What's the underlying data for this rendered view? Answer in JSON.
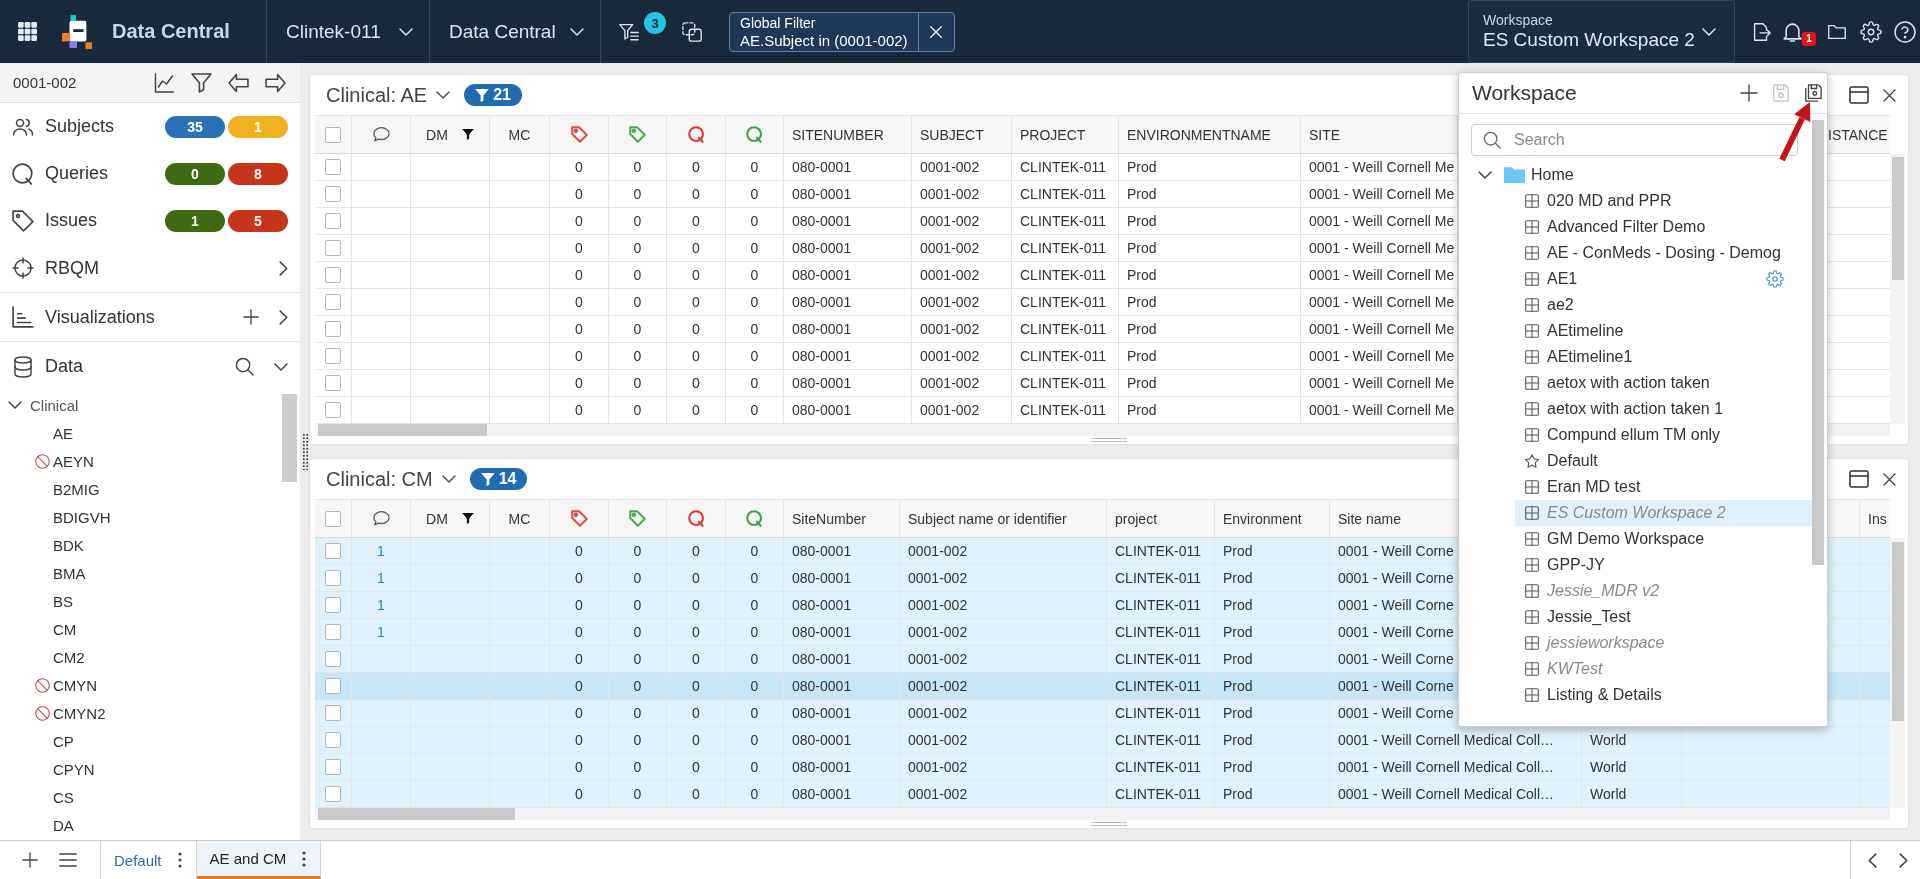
{
  "topbar": {
    "app_name": "Data Central",
    "dropdowns": [
      {
        "label": "Clintek-011"
      },
      {
        "label": "Data Central"
      }
    ],
    "filter_count": "3",
    "global_filter": {
      "title": "Global Filter",
      "value": "AE.Subject in (0001-002)"
    },
    "workspace": {
      "caption": "Workspace",
      "value": "ES Custom Workspace 2"
    },
    "notification_count": "1"
  },
  "sidebar": {
    "subject": "0001-002",
    "nav": [
      {
        "kind": "counts",
        "label": "Subjects",
        "badges": [
          {
            "value": "35",
            "color": "#2a72b8"
          },
          {
            "value": "1",
            "color": "#efb11f"
          }
        ]
      },
      {
        "kind": "counts",
        "label": "Queries",
        "badges": [
          {
            "value": "0",
            "color": "#3e6a12"
          },
          {
            "value": "8",
            "color": "#c6341b"
          }
        ]
      },
      {
        "kind": "counts",
        "label": "Issues",
        "badges": [
          {
            "value": "1",
            "color": "#3e6a12"
          },
          {
            "value": "5",
            "color": "#c6341b"
          }
        ]
      },
      {
        "kind": "link",
        "label": "RBQM"
      },
      {
        "kind": "add-link",
        "label": "Visualizations"
      },
      {
        "kind": "search",
        "label": "Data",
        "expanded": true
      }
    ],
    "tree": [
      {
        "label": "Clinical",
        "expanded": true,
        "children": [
          {
            "label": "AE",
            "restricted": false
          },
          {
            "label": "AEYN",
            "restricted": true
          },
          {
            "label": "B2MIG",
            "restricted": false
          },
          {
            "label": "BDIGVH",
            "restricted": false
          },
          {
            "label": "BDK",
            "restricted": false
          },
          {
            "label": "BMA",
            "restricted": false
          },
          {
            "label": "BS",
            "restricted": false
          },
          {
            "label": "CM",
            "restricted": false
          },
          {
            "label": "CM2",
            "restricted": false
          },
          {
            "label": "CMYN",
            "restricted": true
          },
          {
            "label": "CMYN2",
            "restricted": true
          },
          {
            "label": "CP",
            "restricted": false
          },
          {
            "label": "CPYN",
            "restricted": false
          },
          {
            "label": "CS",
            "restricted": false
          },
          {
            "label": "DA",
            "restricted": false
          }
        ]
      }
    ]
  },
  "panels": [
    {
      "title": "Clinical: AE",
      "filter_count": "21",
      "highlighted": false,
      "header_checked": false,
      "columns": [
        {
          "kind": "comment"
        },
        {
          "kind": "marker",
          "label": "DM",
          "filtered": true
        },
        {
          "kind": "marker",
          "label": "MC",
          "filtered": false
        },
        {
          "kind": "tag",
          "color": "#e0533d"
        },
        {
          "kind": "tag",
          "color": "#4caf50"
        },
        {
          "kind": "query",
          "color": "#e53935"
        },
        {
          "kind": "query",
          "color": "#43a047"
        },
        {
          "kind": "data",
          "label": "SITENUMBER",
          "filtered": false
        },
        {
          "kind": "data",
          "label": "SUBJECT",
          "filtered": false
        },
        {
          "kind": "data",
          "label": "PROJECT",
          "filtered": false
        },
        {
          "kind": "data",
          "label": "ENVIRONMENTNAME",
          "filtered": false
        },
        {
          "kind": "data",
          "label": "SITE",
          "filtered": false
        }
      ],
      "edge_column": "ISTANCE",
      "rows": [
        {
          "checked": false,
          "selected": false,
          "counts": [
            "0",
            "0",
            "0",
            "0"
          ],
          "values": [
            "080-0001",
            "0001-002",
            "CLINTEK-011",
            "Prod",
            "0001 - Weill Cornell Me"
          ]
        },
        {
          "checked": false,
          "selected": false,
          "counts": [
            "0",
            "0",
            "0",
            "0"
          ],
          "values": [
            "080-0001",
            "0001-002",
            "CLINTEK-011",
            "Prod",
            "0001 - Weill Cornell Me"
          ]
        },
        {
          "checked": false,
          "selected": false,
          "counts": [
            "0",
            "0",
            "0",
            "0"
          ],
          "values": [
            "080-0001",
            "0001-002",
            "CLINTEK-011",
            "Prod",
            "0001 - Weill Cornell Me"
          ]
        },
        {
          "checked": false,
          "selected": false,
          "counts": [
            "0",
            "0",
            "0",
            "0"
          ],
          "values": [
            "080-0001",
            "0001-002",
            "CLINTEK-011",
            "Prod",
            "0001 - Weill Cornell Me"
          ]
        },
        {
          "checked": false,
          "selected": false,
          "counts": [
            "0",
            "0",
            "0",
            "0"
          ],
          "values": [
            "080-0001",
            "0001-002",
            "CLINTEK-011",
            "Prod",
            "0001 - Weill Cornell Me"
          ]
        },
        {
          "checked": false,
          "selected": false,
          "counts": [
            "0",
            "0",
            "0",
            "0"
          ],
          "values": [
            "080-0001",
            "0001-002",
            "CLINTEK-011",
            "Prod",
            "0001 - Weill Cornell Me"
          ]
        },
        {
          "checked": false,
          "selected": false,
          "counts": [
            "0",
            "0",
            "0",
            "0"
          ],
          "values": [
            "080-0001",
            "0001-002",
            "CLINTEK-011",
            "Prod",
            "0001 - Weill Cornell Me"
          ]
        },
        {
          "checked": false,
          "selected": false,
          "counts": [
            "0",
            "0",
            "0",
            "0"
          ],
          "values": [
            "080-0001",
            "0001-002",
            "CLINTEK-011",
            "Prod",
            "0001 - Weill Cornell Me"
          ]
        },
        {
          "checked": false,
          "selected": false,
          "counts": [
            "0",
            "0",
            "0",
            "0"
          ],
          "values": [
            "080-0001",
            "0001-002",
            "CLINTEK-011",
            "Prod",
            "0001 - Weill Cornell Me"
          ]
        },
        {
          "checked": false,
          "selected": false,
          "counts": [
            "0",
            "0",
            "0",
            "0"
          ],
          "values": [
            "080-0001",
            "0001-002",
            "CLINTEK-011",
            "Prod",
            "0001 - Weill Cornell Me"
          ]
        }
      ]
    },
    {
      "title": "Clinical: CM",
      "filter_count": "14",
      "highlighted": true,
      "header_checked": false,
      "columns": [
        {
          "kind": "comment"
        },
        {
          "kind": "marker",
          "label": "DM",
          "filtered": true
        },
        {
          "kind": "marker",
          "label": "MC",
          "filtered": false
        },
        {
          "kind": "tag",
          "color": "#e0533d"
        },
        {
          "kind": "tag",
          "color": "#4caf50"
        },
        {
          "kind": "query",
          "color": "#e53935"
        },
        {
          "kind": "query",
          "color": "#43a047"
        },
        {
          "kind": "data",
          "label": "SiteNumber",
          "filtered": false
        },
        {
          "kind": "data",
          "label": "Subject name or identifier",
          "filtered": false
        },
        {
          "kind": "data",
          "label": "project",
          "filtered": false
        },
        {
          "kind": "data",
          "label": "Environment",
          "filtered": false
        },
        {
          "kind": "data",
          "label": "Site name",
          "filtered": false
        }
      ],
      "edge_column": "Ins",
      "rows": [
        {
          "checked": false,
          "selected": false,
          "comment_count": "1",
          "counts": [
            "0",
            "0",
            "0",
            "0"
          ],
          "values": [
            "080-0001",
            "0001-002",
            "CLINTEK-011",
            "Prod",
            "0001 - Weill Corne"
          ]
        },
        {
          "checked": false,
          "selected": false,
          "comment_count": "1",
          "counts": [
            "0",
            "0",
            "0",
            "0"
          ],
          "values": [
            "080-0001",
            "0001-002",
            "CLINTEK-011",
            "Prod",
            "0001 - Weill Corne"
          ]
        },
        {
          "checked": false,
          "selected": false,
          "comment_count": "1",
          "counts": [
            "0",
            "0",
            "0",
            "0"
          ],
          "values": [
            "080-0001",
            "0001-002",
            "CLINTEK-011",
            "Prod",
            "0001 - Weill Corne"
          ]
        },
        {
          "checked": false,
          "selected": false,
          "comment_count": "1",
          "counts": [
            "0",
            "0",
            "0",
            "0"
          ],
          "values": [
            "080-0001",
            "0001-002",
            "CLINTEK-011",
            "Prod",
            "0001 - Weill Corne"
          ]
        },
        {
          "checked": false,
          "selected": false,
          "counts": [
            "0",
            "0",
            "0",
            "0"
          ],
          "values": [
            "080-0001",
            "0001-002",
            "CLINTEK-011",
            "Prod",
            "0001 - Weill Corne"
          ]
        },
        {
          "checked": false,
          "selected": true,
          "counts": [
            "0",
            "0",
            "0",
            "0"
          ],
          "values": [
            "080-0001",
            "0001-002",
            "CLINTEK-011",
            "Prod",
            "0001 - Weill Corne"
          ]
        },
        {
          "checked": false,
          "selected": false,
          "counts": [
            "0",
            "0",
            "0",
            "0"
          ],
          "values": [
            "080-0001",
            "0001-002",
            "CLINTEK-011",
            "Prod",
            "0001 - Weill Corne"
          ]
        },
        {
          "checked": false,
          "selected": false,
          "counts": [
            "0",
            "0",
            "0",
            "0"
          ],
          "values": [
            "080-0001",
            "0001-002",
            "CLINTEK-011",
            "Prod",
            "0001 - Weill Cornell Medical Coll…",
            "World"
          ]
        },
        {
          "checked": false,
          "selected": false,
          "counts": [
            "0",
            "0",
            "0",
            "0"
          ],
          "values": [
            "080-0001",
            "0001-002",
            "CLINTEK-011",
            "Prod",
            "0001 - Weill Cornell Medical Coll…",
            "World"
          ]
        },
        {
          "checked": false,
          "selected": false,
          "counts": [
            "0",
            "0",
            "0",
            "0"
          ],
          "values": [
            "080-0001",
            "0001-002",
            "CLINTEK-011",
            "Prod",
            "0001 - Weill Cornell Medical Coll…",
            "World"
          ]
        }
      ]
    }
  ],
  "workspace_panel": {
    "title": "Workspace",
    "actions": [
      {
        "kind": "add",
        "disabled": false
      },
      {
        "kind": "save",
        "disabled": true
      },
      {
        "kind": "save-as",
        "disabled": false
      }
    ],
    "search": {
      "placeholder": "Search"
    },
    "tree": [
      {
        "label": "Home",
        "expanded": true,
        "children": [
          {
            "label": "020 MD and PPR",
            "kind": "workspace",
            "selected": false,
            "muted": false,
            "hovered": false
          },
          {
            "label": "Advanced Filter Demo",
            "kind": "workspace",
            "selected": false,
            "muted": false,
            "hovered": false
          },
          {
            "label": "AE - ConMeds - Dosing - Demog",
            "kind": "workspace",
            "selected": false,
            "muted": false,
            "hovered": false
          },
          {
            "label": "AE1",
            "kind": "workspace",
            "selected": false,
            "muted": false,
            "hovered": true
          },
          {
            "label": "ae2",
            "kind": "workspace",
            "selected": false,
            "muted": false,
            "hovered": false
          },
          {
            "label": "AEtimeline",
            "kind": "workspace",
            "selected": false,
            "muted": false,
            "hovered": false
          },
          {
            "label": "AEtimeline1",
            "kind": "workspace",
            "selected": false,
            "muted": false,
            "hovered": false
          },
          {
            "label": "aetox with action taken",
            "kind": "workspace",
            "selected": false,
            "muted": false,
            "hovered": false
          },
          {
            "label": "aetox with action taken 1",
            "kind": "workspace",
            "selected": false,
            "muted": false,
            "hovered": false
          },
          {
            "label": "Compund ellum TM only",
            "kind": "workspace",
            "selected": false,
            "muted": false,
            "hovered": false
          },
          {
            "label": "Default",
            "kind": "default",
            "selected": false,
            "muted": false,
            "hovered": false
          },
          {
            "label": "Eran MD test",
            "kind": "workspace",
            "selected": false,
            "muted": false,
            "hovered": false
          },
          {
            "label": "ES Custom Workspace 2",
            "kind": "workspace",
            "selected": true,
            "muted": true,
            "hovered": false
          },
          {
            "label": "GM Demo Workspace",
            "kind": "workspace",
            "selected": false,
            "muted": false,
            "hovered": false
          },
          {
            "label": "GPP-JY",
            "kind": "workspace",
            "selected": false,
            "muted": false,
            "hovered": false
          },
          {
            "label": "Jessie_MDR v2",
            "kind": "workspace",
            "selected": false,
            "muted": true,
            "hovered": false
          },
          {
            "label": "Jessie_Test",
            "kind": "workspace",
            "selected": false,
            "muted": false,
            "hovered": false
          },
          {
            "label": "jessieworkspace",
            "kind": "workspace",
            "selected": false,
            "muted": true,
            "hovered": false
          },
          {
            "label": "KWTest",
            "kind": "workspace",
            "selected": false,
            "muted": true,
            "hovered": false
          },
          {
            "label": "Listing & Details",
            "kind": "workspace",
            "selected": false,
            "muted": false,
            "hovered": false
          }
        ]
      }
    ]
  },
  "callout_arrow": true,
  "bottom_bar": {
    "tabs": [
      {
        "label": "Default",
        "selected": false
      },
      {
        "label": "AE and CM",
        "selected": true
      }
    ]
  }
}
